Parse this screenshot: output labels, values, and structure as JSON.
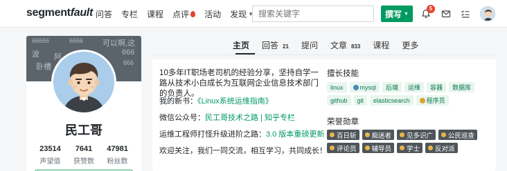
{
  "header": {
    "logo_main": "segment",
    "logo_italic": "fault",
    "nav": [
      "问答",
      "专栏",
      "课程",
      "点评",
      "活动",
      "发现"
    ],
    "search_placeholder": "搜索关键字",
    "write_label": "撰写",
    "notification_count": "5"
  },
  "profile": {
    "cover_texts": [
      "66666",
      "6666",
      "可以啊,这",
      "波",
      "666",
      "阿",
      "666",
      "卧槽",
      "666"
    ],
    "name": "民工哥",
    "stats": [
      {
        "value": "23514",
        "label": "声望值"
      },
      {
        "value": "7641",
        "label": "获赞数"
      },
      {
        "value": "47981",
        "label": "粉丝数"
      }
    ]
  },
  "tabs": [
    {
      "label": "主页",
      "count": ""
    },
    {
      "label": "回答",
      "count": "21"
    },
    {
      "label": "提问",
      "count": ""
    },
    {
      "label": "文章",
      "count": "833"
    },
    {
      "label": "课程",
      "count": ""
    },
    {
      "label": "更多",
      "count": ""
    }
  ],
  "about": {
    "bio": "10多年IT职场老司机的经验分享，坚持自学一路从技术小白成长为互联网企业信息技术部门的负责人。",
    "book_prefix": "我的新书：",
    "book_title": "《Linux系统运维指南》",
    "wechat_prefix": "微信公众号：",
    "wechat_name": "民工哥技术之路",
    "wechat_sep": " | ",
    "wechat_column": "知乎专栏",
    "path_prefix": "运维工程师打怪升级进阶之路：",
    "path_link": "3.0 版本重磅更新",
    "welcome": "欢迎关注，我们一同交流，相互学习，共同成长！！"
  },
  "skills": {
    "title": "擅长技能",
    "tags": [
      "linux",
      "mysql",
      "后端",
      "运维",
      "容器",
      "数据库",
      "github",
      "git",
      "elasticsearch",
      "程序员"
    ]
  },
  "honors": {
    "title": "荣誉勋章",
    "medals": [
      "百日斩",
      "痴迷者",
      "见多识广",
      "公民巡查",
      "评论员",
      "辅导员",
      "学士",
      "反对派"
    ]
  },
  "colors": {
    "brand_green": "#009a61",
    "badge_red": "#e8422f",
    "medal_bg": "#4e555b"
  }
}
